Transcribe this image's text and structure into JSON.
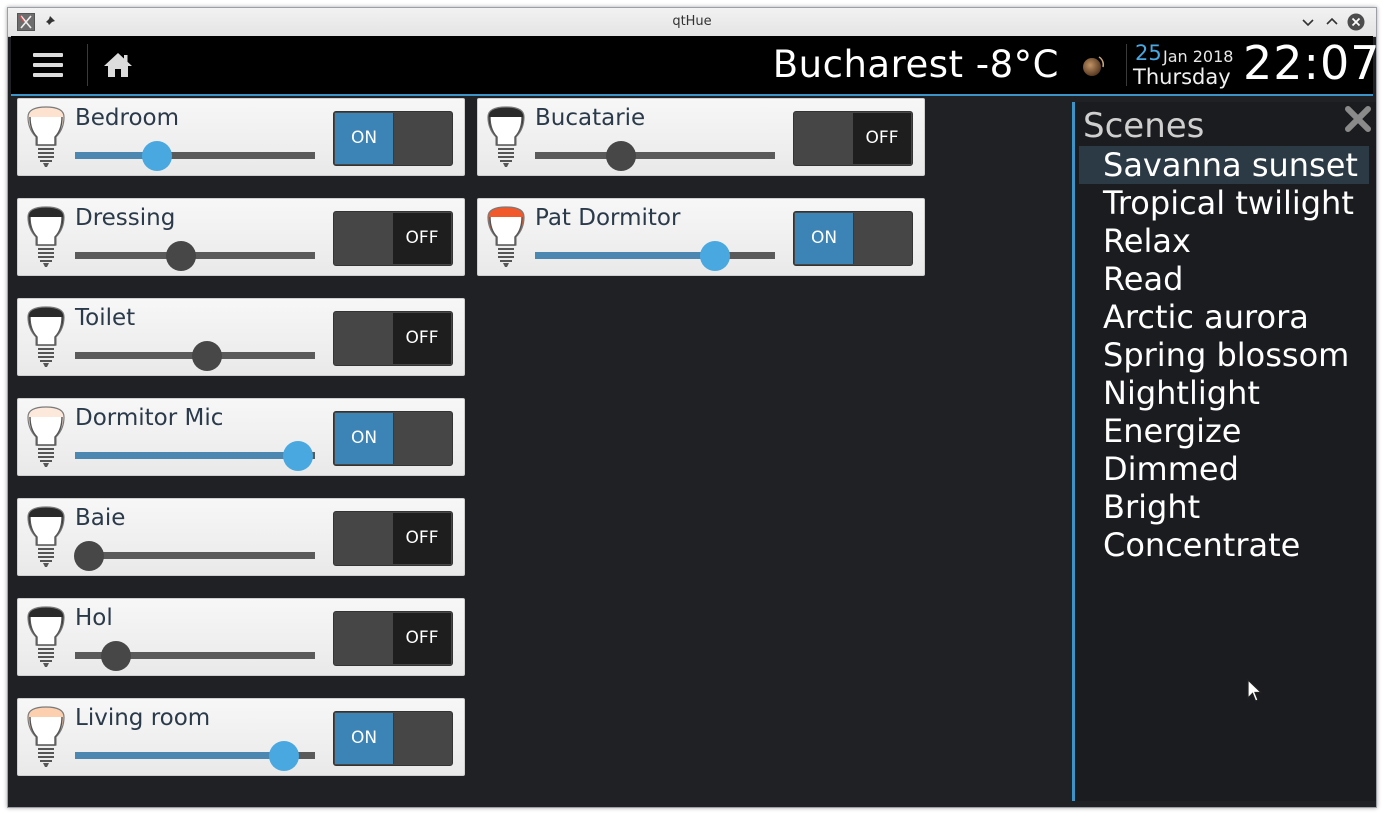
{
  "window": {
    "title": "qtHue"
  },
  "header": {
    "weather": "Bucharest -8°C",
    "date_day": "25",
    "date_month_year": "Jan 2018",
    "date_weekday": "Thursday",
    "clock": "22:07"
  },
  "lights": [
    {
      "name": "Bedroom",
      "on": true,
      "switch_label": "ON",
      "brightness": 0.34,
      "bulb_color": "#fde3cf"
    },
    {
      "name": "Dressing",
      "on": false,
      "switch_label": "OFF",
      "brightness": 0.44,
      "bulb_color": "#2a2a2a"
    },
    {
      "name": "Toilet",
      "on": false,
      "switch_label": "OFF",
      "brightness": 0.55,
      "bulb_color": "#2a2a2a"
    },
    {
      "name": "Dormitor Mic",
      "on": true,
      "switch_label": "ON",
      "brightness": 0.93,
      "bulb_color": "#fde8dc"
    },
    {
      "name": "Baie",
      "on": false,
      "switch_label": "OFF",
      "brightness": 0.06,
      "bulb_color": "#2a2a2a"
    },
    {
      "name": "Hol",
      "on": false,
      "switch_label": "OFF",
      "brightness": 0.17,
      "bulb_color": "#2a2a2a"
    },
    {
      "name": "Living room",
      "on": true,
      "switch_label": "ON",
      "brightness": 0.87,
      "bulb_color": "#fccfae"
    },
    {
      "name": "Bucatarie",
      "on": false,
      "switch_label": "OFF",
      "brightness": 0.36,
      "bulb_color": "#2a2a2a"
    },
    {
      "name": "Pat Dormitor",
      "on": true,
      "switch_label": "ON",
      "brightness": 0.75,
      "bulb_color": "#f1592a"
    }
  ],
  "scenes": {
    "heading": "Scenes",
    "items": [
      "Savanna sunset",
      "Tropical twilight",
      "Relax",
      "Read",
      "Arctic aurora",
      "Spring blossom",
      "Nightlight",
      "Energize",
      "Dimmed",
      "Bright",
      "Concentrate"
    ],
    "selected": 0
  },
  "colors": {
    "accent": "#3b93c7",
    "switch_on": "#3c83b6",
    "thumb_on": "#4aa8e0",
    "slider_fill": "#4b87b0",
    "app_bg": "#202124"
  }
}
